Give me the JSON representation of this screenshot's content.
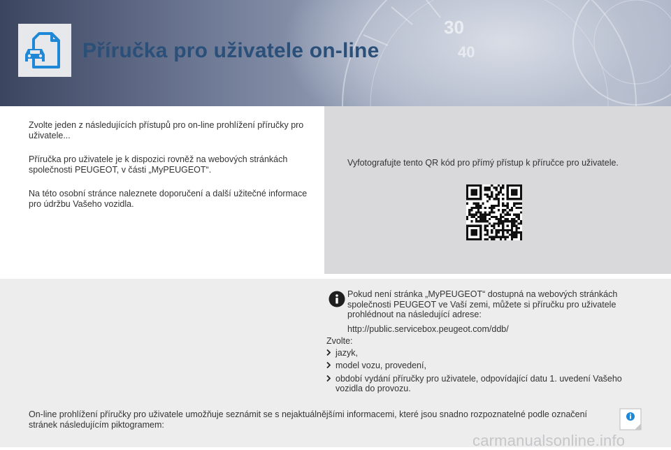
{
  "header": {
    "title": "Příručka pro uživatele on-line",
    "icon": "car-document-icon",
    "background_numbers": [
      "30",
      "40"
    ]
  },
  "intro": {
    "paragraphs": [
      "Zvolte jeden z následujících přístupů pro on-line prohlížení příručky pro uživatele...",
      "Příručka pro uživatele je k dispozici rovněž na webových stránkách společnosti PEUGEOT, v části „MyPEUGEOT“.",
      "Na této osobní stránce naleznete doporučení a další užitečné informace pro údržbu Vašeho vozidla."
    ]
  },
  "qr_panel": {
    "caption": "Vyfotografujte tento QR kód pro přímý přístup k příručce pro uživatele.",
    "icon": "qr-code"
  },
  "info": {
    "icon": "info-icon",
    "text": "Pokud není stránka „MyPEUGEOT“ dostupná na webových stránkách společnosti PEUGEOT ve Vaší zemi, můžete si příručku pro uživatele prohlédnout na následující adrese:",
    "url": "http://public.servicebox.peugeot.com/ddb/"
  },
  "choose": {
    "label": "Zvolte:",
    "items": [
      "jazyk,",
      "model vozu, provedení,",
      "období vydání příručky pro uživatele, odpovídající datu 1. uvedení Vašeho vozidla do provozu."
    ]
  },
  "footer": {
    "text": "On-line prohlížení příručky pro uživatele umožňuje seznámit se s nejaktuálnějšími informacemi, které jsou snadno rozpoznatelné podle označení stránek následujícím piktogramem:",
    "pictogram": "info-pictogram-icon"
  },
  "watermark": "carmanualsonline.info",
  "colors": {
    "title": "#2a4f78",
    "accent_blue": "#1e88d6",
    "panel_gray": "#d9d9db"
  }
}
